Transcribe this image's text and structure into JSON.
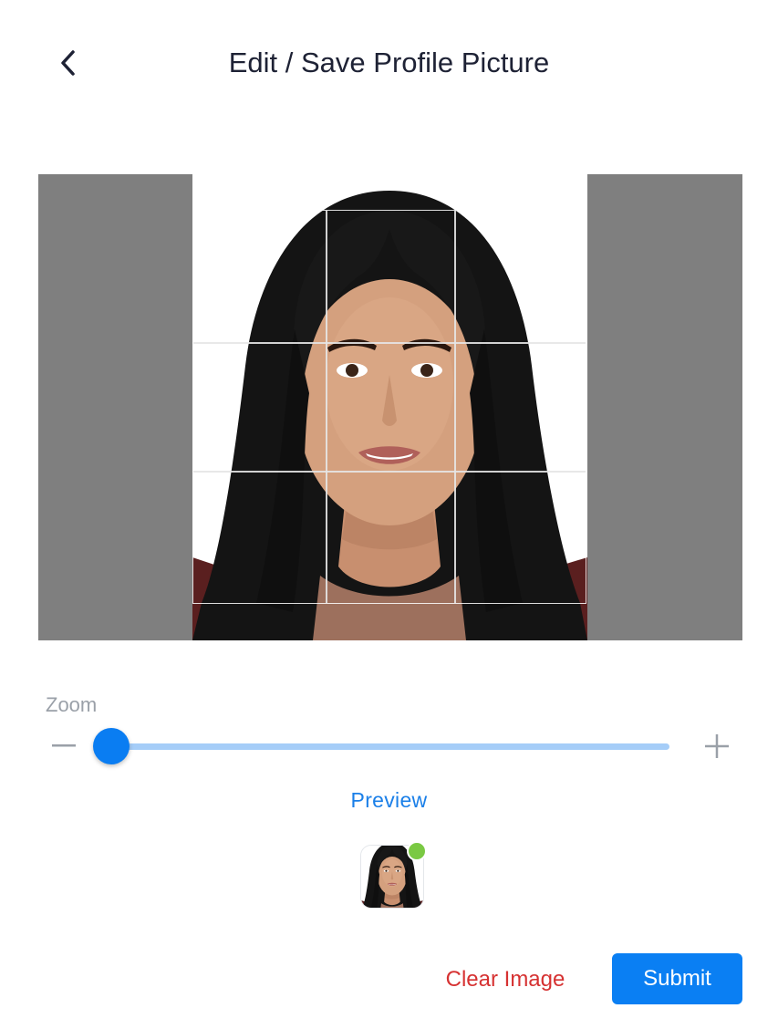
{
  "header": {
    "title": "Edit / Save Profile Picture",
    "back_icon": "chevron-left-icon"
  },
  "cropper": {
    "background_color": "#7f7f7f",
    "grid": "3x3"
  },
  "zoom": {
    "label": "Zoom",
    "minus_icon": "minus-icon",
    "plus_icon": "plus-icon",
    "level": 0.0,
    "track_color": "#a5cdf8",
    "thumb_color": "#0a7df2"
  },
  "preview": {
    "label": "Preview",
    "status_color": "#7ac943"
  },
  "actions": {
    "clear_label": "Clear Image",
    "submit_label": "Submit",
    "clear_color": "#d63232",
    "submit_color": "#0a7ff3"
  }
}
